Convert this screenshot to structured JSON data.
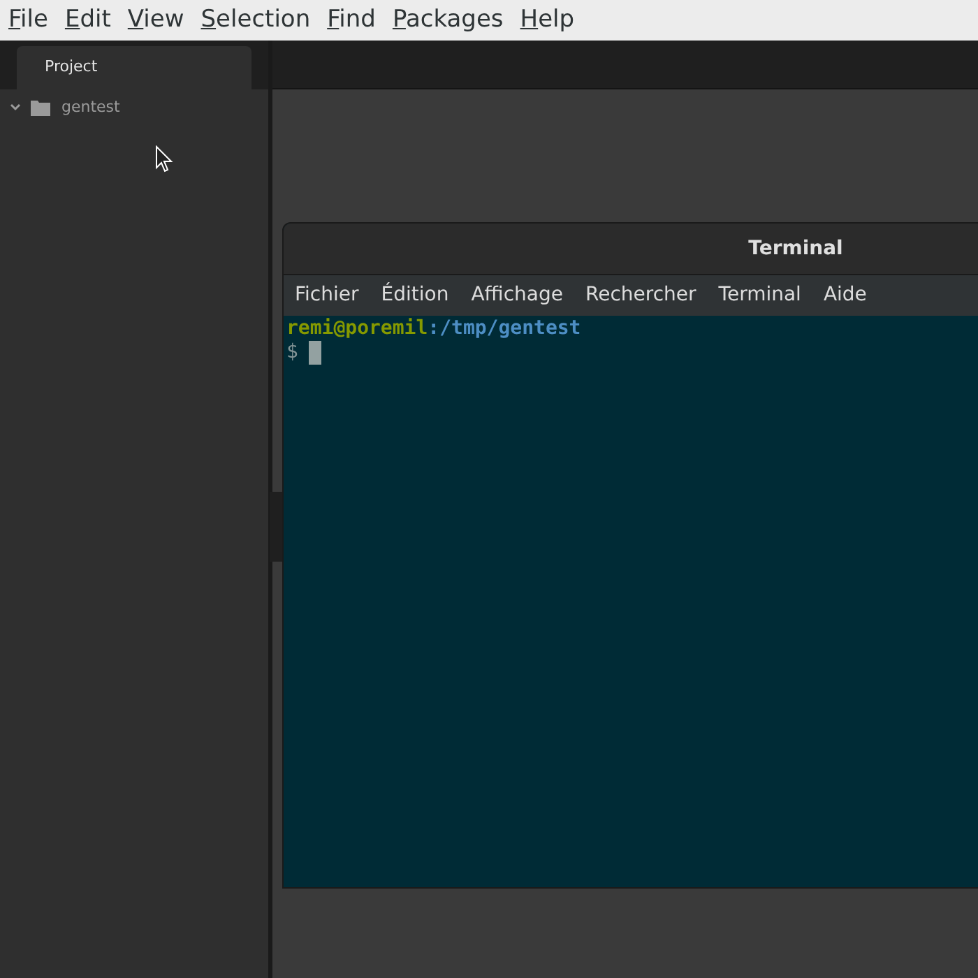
{
  "menu_bar": [
    {
      "label": "File"
    },
    {
      "label": "Edit"
    },
    {
      "label": "View"
    },
    {
      "label": "Selection"
    },
    {
      "label": "Find"
    },
    {
      "label": "Packages"
    },
    {
      "label": "Help"
    }
  ],
  "tabs": [
    {
      "label": "Project",
      "selected": true
    }
  ],
  "tree": [
    {
      "name": "gentest",
      "expanded": true
    }
  ],
  "terminal": {
    "title": "Terminal",
    "menu": [
      {
        "label": "Fichier"
      },
      {
        "label": "Édition"
      },
      {
        "label": "Affichage"
      },
      {
        "label": "Rechercher"
      },
      {
        "label": "Terminal"
      },
      {
        "label": "Aide"
      }
    ],
    "prompt_user": "remi@poremil",
    "prompt_path": ":/tmp/gentest",
    "prompt_symbol": "$"
  }
}
